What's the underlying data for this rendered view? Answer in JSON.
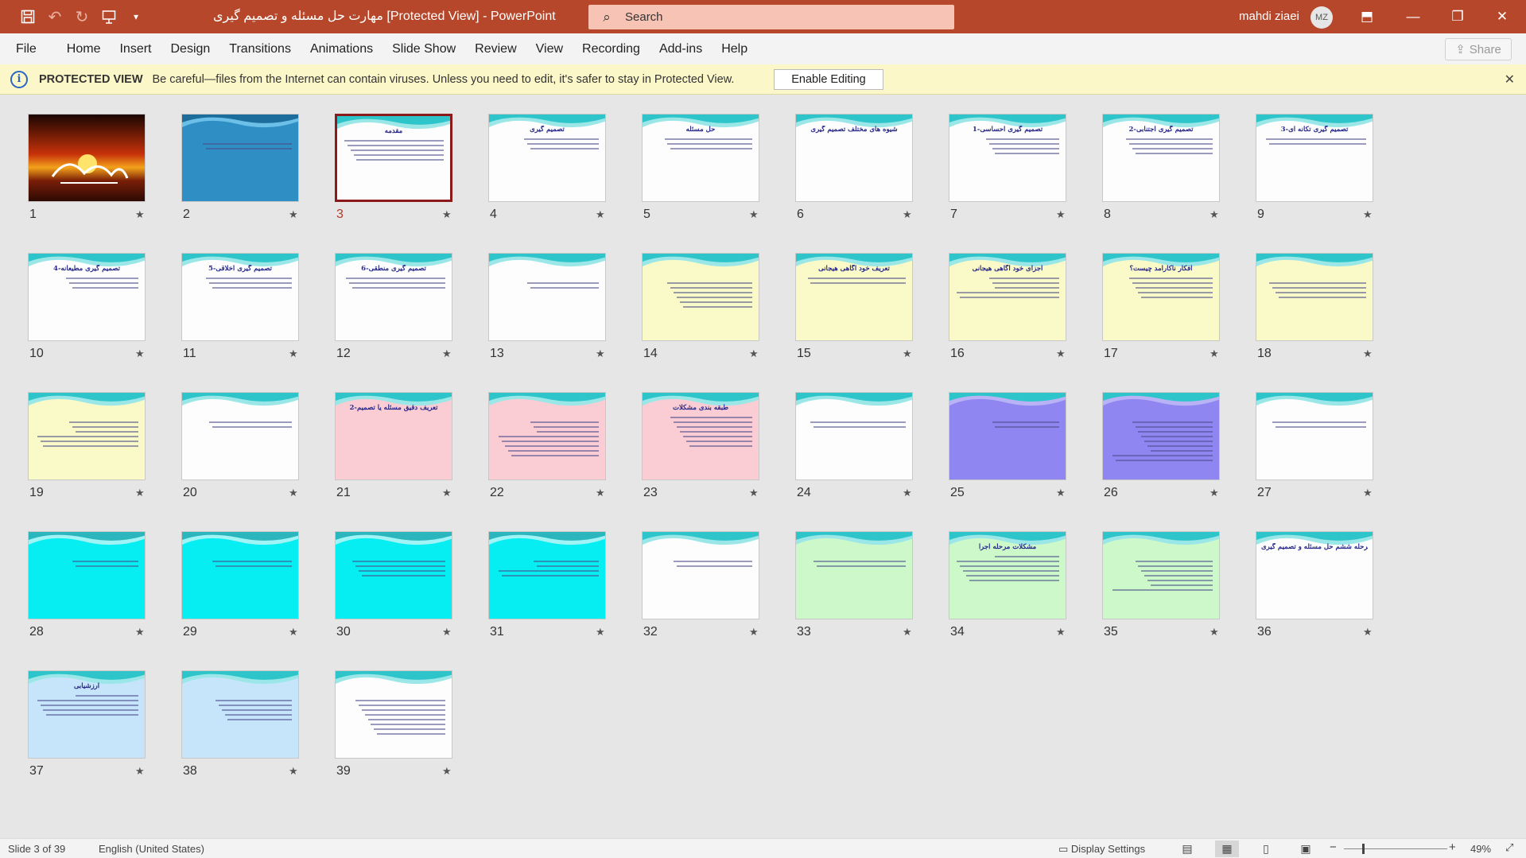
{
  "titlebar": {
    "doc_title": "مهارت حل مسئله و تصمیم گیری [Protected View]  -  PowerPoint",
    "search_placeholder": "Search",
    "user_name": "mahdi ziaei",
    "user_initials": "MZ"
  },
  "menu": [
    "File",
    "Home",
    "Insert",
    "Design",
    "Transitions",
    "Animations",
    "Slide Show",
    "Review",
    "View",
    "Recording",
    "Add-ins",
    "Help"
  ],
  "share_label": "Share",
  "protected_view": {
    "title": "PROTECTED VIEW",
    "message": "Be careful—files from the Internet can contain viruses. Unless you need to edit, it's safer to stay in Protected View.",
    "button": "Enable Editing"
  },
  "selected_slide": 3,
  "slides": [
    {
      "n": "1",
      "title": "",
      "theme": "photo"
    },
    {
      "n": "2",
      "title": "",
      "theme": "blue"
    },
    {
      "n": "3",
      "title": "مقدمه",
      "theme": "white"
    },
    {
      "n": "4",
      "title": "تصمیم گیری",
      "theme": "white"
    },
    {
      "n": "5",
      "title": "حل مسئله",
      "theme": "white"
    },
    {
      "n": "6",
      "title": "شیوه های مختلف تصمیم گیری",
      "theme": "white"
    },
    {
      "n": "7",
      "title": "1-تصمیم گیری احساسی",
      "theme": "white"
    },
    {
      "n": "8",
      "title": "2-تصمیم گیری اجتنابی",
      "theme": "white"
    },
    {
      "n": "9",
      "title": "3-تصمیم گیری تکانه ای",
      "theme": "white"
    },
    {
      "n": "10",
      "title": "4-تصمیم گیری مطیعانه",
      "theme": "white"
    },
    {
      "n": "11",
      "title": "5-تصمیم گیری اخلاقی",
      "theme": "white"
    },
    {
      "n": "12",
      "title": "6-تصمیم گیری منطقی",
      "theme": "white"
    },
    {
      "n": "13",
      "title": "",
      "theme": "white"
    },
    {
      "n": "14",
      "title": "",
      "theme": "yellow"
    },
    {
      "n": "15",
      "title": "تعریف خود آگاهی هیجانی",
      "theme": "yellow"
    },
    {
      "n": "16",
      "title": "اجزای خود آگاهی هیجانی",
      "theme": "yellow"
    },
    {
      "n": "17",
      "title": "افکار ناکارآمد چیست؟",
      "theme": "yellow"
    },
    {
      "n": "18",
      "title": "",
      "theme": "yellow"
    },
    {
      "n": "19",
      "title": "",
      "theme": "yellow"
    },
    {
      "n": "20",
      "title": "",
      "theme": "white"
    },
    {
      "n": "21",
      "title": "2-تعریف دقیق مسئله یا تصمیم",
      "theme": "pink"
    },
    {
      "n": "22",
      "title": "",
      "theme": "pink"
    },
    {
      "n": "23",
      "title": "طبقه بندی مشکلات",
      "theme": "pink"
    },
    {
      "n": "24",
      "title": "",
      "theme": "white"
    },
    {
      "n": "25",
      "title": "",
      "theme": "purple"
    },
    {
      "n": "26",
      "title": "",
      "theme": "purple"
    },
    {
      "n": "27",
      "title": "",
      "theme": "white"
    },
    {
      "n": "28",
      "title": "",
      "theme": "cyan"
    },
    {
      "n": "29",
      "title": "",
      "theme": "cyan"
    },
    {
      "n": "30",
      "title": "",
      "theme": "cyan"
    },
    {
      "n": "31",
      "title": "",
      "theme": "cyan"
    },
    {
      "n": "32",
      "title": "",
      "theme": "white"
    },
    {
      "n": "33",
      "title": "",
      "theme": "green"
    },
    {
      "n": "34",
      "title": "مشکلات مرحله اجرا",
      "theme": "green"
    },
    {
      "n": "35",
      "title": "",
      "theme": "green"
    },
    {
      "n": "36",
      "title": "مرحله ششم حل مسئله و تصمیم گیری",
      "theme": "white"
    },
    {
      "n": "37",
      "title": "ارزشیابی",
      "theme": "lightblue"
    },
    {
      "n": "38",
      "title": "",
      "theme": "lightblue"
    },
    {
      "n": "39",
      "title": "",
      "theme": "white"
    }
  ],
  "status": {
    "slide_info": "Slide 3 of 39",
    "language": "English (United States)",
    "display_settings": "Display Settings",
    "zoom": "49%"
  },
  "colors": {
    "titlebar": "#b7472a",
    "selected_border": "#8b1b1b"
  }
}
